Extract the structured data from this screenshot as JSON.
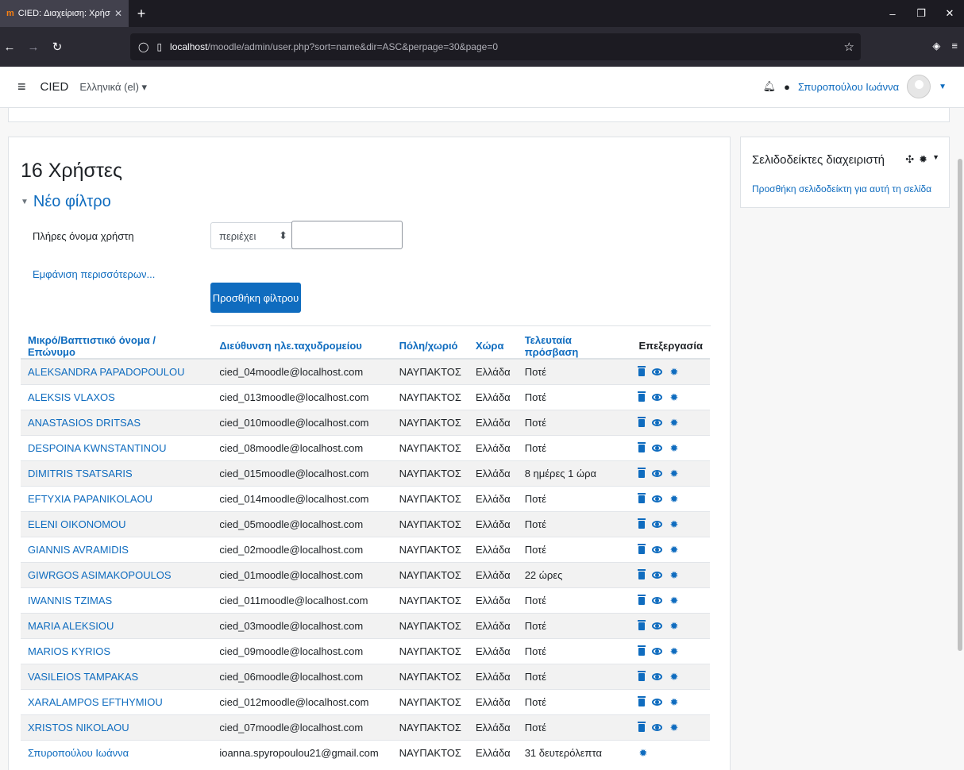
{
  "browser": {
    "tab_title": "CIED: Διαχείριση: Χρήστες: Λογ",
    "tab_favicon": "moodle-icon",
    "new_tab": "+",
    "url_host": "localhost",
    "url_rest": "/moodle/admin/user.php?sort=name&dir=ASC&perpage=30&page=0"
  },
  "header": {
    "menu": "≡",
    "brand": "CIED",
    "language": "Ελληνικά (el)",
    "user_name": "Σπυροπούλου Ιωάννα"
  },
  "page": {
    "title": "16 Χρήστες",
    "filter_heading": "Νέο φίλτρο",
    "filter_label": "Πλήρες όνομα χρήστη",
    "filter_operator": "περιέχει",
    "filter_value": "",
    "show_more": "Εμφάνιση περισσότερων...",
    "add_filter": "Προσθήκη φίλτρου"
  },
  "table": {
    "headers": [
      "Μικρό/Βαπτιστικό όνομα / Επώνυμο",
      "Διεύθυνση ηλε.ταχυδρομείου",
      "Πόλη/χωριό",
      "Χώρα",
      "Τελευταία πρόσβαση",
      "Επεξεργασία"
    ],
    "rows": [
      {
        "name": "ALEKSANDRA PAPADOPOULOU",
        "email": "cied_04moodle@localhost.com",
        "city": "ΝΑΥΠΑΚΤΟΣ",
        "country": "Ελλάδα",
        "last": "Ποτέ"
      },
      {
        "name": "ALEKSIS VLAXOS",
        "email": "cied_013moodle@localhost.com",
        "city": "ΝΑΥΠΑΚΤΟΣ",
        "country": "Ελλάδα",
        "last": "Ποτέ"
      },
      {
        "name": "ANASTASIOS DRITSAS",
        "email": "cied_010moodle@localhost.com",
        "city": "ΝΑΥΠΑΚΤΟΣ",
        "country": "Ελλάδα",
        "last": "Ποτέ"
      },
      {
        "name": "DESPOINA KWNSTANTINOU",
        "email": "cied_08moodle@localhost.com",
        "city": "ΝΑΥΠΑΚΤΟΣ",
        "country": "Ελλάδα",
        "last": "Ποτέ"
      },
      {
        "name": "DIMITRIS TSATSARIS",
        "email": "cied_015moodle@localhost.com",
        "city": "ΝΑΥΠΑΚΤΟΣ",
        "country": "Ελλάδα",
        "last": "8 ημέρες 1 ώρα"
      },
      {
        "name": "EFTYXIA PAPANIKOLAOU",
        "email": "cied_014moodle@localhost.com",
        "city": "ΝΑΥΠΑΚΤΟΣ",
        "country": "Ελλάδα",
        "last": "Ποτέ"
      },
      {
        "name": "ELENI OIKONOMOU",
        "email": "cied_05moodle@localhost.com",
        "city": "ΝΑΥΠΑΚΤΟΣ",
        "country": "Ελλάδα",
        "last": "Ποτέ"
      },
      {
        "name": "GIANNIS AVRAMIDIS",
        "email": "cied_02moodle@localhost.com",
        "city": "ΝΑΥΠΑΚΤΟΣ",
        "country": "Ελλάδα",
        "last": "Ποτέ"
      },
      {
        "name": "GIWRGOS ASIMAKOPOULOS",
        "email": "cied_01moodle@localhost.com",
        "city": "ΝΑΥΠΑΚΤΟΣ",
        "country": "Ελλάδα",
        "last": "22 ώρες"
      },
      {
        "name": "IWANNIS TZIMAS",
        "email": "cied_011moodle@localhost.com",
        "city": "ΝΑΥΠΑΚΤΟΣ",
        "country": "Ελλάδα",
        "last": "Ποτέ"
      },
      {
        "name": "MARIA ALEKSIOU",
        "email": "cied_03moodle@localhost.com",
        "city": "ΝΑΥΠΑΚΤΟΣ",
        "country": "Ελλάδα",
        "last": "Ποτέ"
      },
      {
        "name": "MARIOS KYRIOS",
        "email": "cied_09moodle@localhost.com",
        "city": "ΝΑΥΠΑΚΤΟΣ",
        "country": "Ελλάδα",
        "last": "Ποτέ"
      },
      {
        "name": "VASILEIOS TAMPAKAS",
        "email": "cied_06moodle@localhost.com",
        "city": "ΝΑΥΠΑΚΤΟΣ",
        "country": "Ελλάδα",
        "last": "Ποτέ"
      },
      {
        "name": "XARALAMPOS EFTHYMIOU",
        "email": "cied_012moodle@localhost.com",
        "city": "ΝΑΥΠΑΚΤΟΣ",
        "country": "Ελλάδα",
        "last": "Ποτέ"
      },
      {
        "name": "XRISTOS NIKOLAOU",
        "email": "cied_07moodle@localhost.com",
        "city": "ΝΑΥΠΑΚΤΟΣ",
        "country": "Ελλάδα",
        "last": "Ποτέ"
      },
      {
        "name": "Σπυροπούλου Ιωάννα",
        "email": "ioanna.spyropoulou21@gmail.com",
        "city": "ΝΑΥΠΑΚΤΟΣ",
        "country": "Ελλάδα",
        "last": "31 δευτερόλεπτα",
        "only_settings": true
      }
    ]
  },
  "sideblock": {
    "title": "Σελιδοδείκτες διαχειριστή",
    "link": "Προσθήκη σελιδοδείκτη για αυτή τη σελίδα"
  },
  "colors": {
    "link": "#0f6cbf",
    "primary_button": "#0f6cbf",
    "text": "#1d2125",
    "browser_dark": "#1c1b22"
  }
}
